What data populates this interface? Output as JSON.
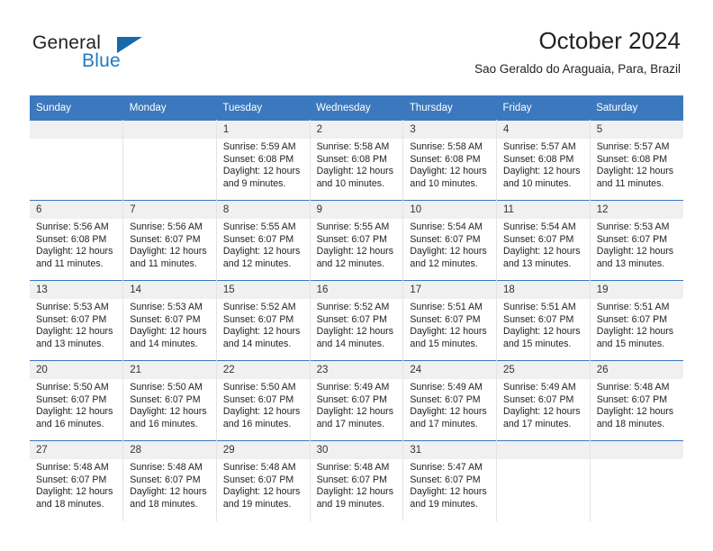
{
  "logo": {
    "word_one": "General",
    "word_two": "Blue",
    "triangle_color": "#1769aa",
    "blue_text_color": "#1f7ac4"
  },
  "header": {
    "title": "October 2024",
    "subtitle": "Sao Geraldo do Araguaia, Para, Brazil",
    "header_bg": "#3b78bd",
    "header_text_color": "#ffffff"
  },
  "weekday_headers": [
    "Sunday",
    "Monday",
    "Tuesday",
    "Wednesday",
    "Thursday",
    "Friday",
    "Saturday"
  ],
  "labels": {
    "sunrise_prefix": "Sunrise:",
    "sunset_prefix": "Sunset:",
    "daylight_prefix": "Daylight:"
  },
  "weeks": [
    [
      {
        "day": "",
        "empty": true
      },
      {
        "day": "",
        "empty": true
      },
      {
        "day": "1",
        "sunrise": "Sunrise: 5:59 AM",
        "sunset": "Sunset: 6:08 PM",
        "daylight_line1": "Daylight: 12 hours",
        "daylight_line2": "and 9 minutes."
      },
      {
        "day": "2",
        "sunrise": "Sunrise: 5:58 AM",
        "sunset": "Sunset: 6:08 PM",
        "daylight_line1": "Daylight: 12 hours",
        "daylight_line2": "and 10 minutes."
      },
      {
        "day": "3",
        "sunrise": "Sunrise: 5:58 AM",
        "sunset": "Sunset: 6:08 PM",
        "daylight_line1": "Daylight: 12 hours",
        "daylight_line2": "and 10 minutes."
      },
      {
        "day": "4",
        "sunrise": "Sunrise: 5:57 AM",
        "sunset": "Sunset: 6:08 PM",
        "daylight_line1": "Daylight: 12 hours",
        "daylight_line2": "and 10 minutes."
      },
      {
        "day": "5",
        "sunrise": "Sunrise: 5:57 AM",
        "sunset": "Sunset: 6:08 PM",
        "daylight_line1": "Daylight: 12 hours",
        "daylight_line2": "and 11 minutes."
      }
    ],
    [
      {
        "day": "6",
        "sunrise": "Sunrise: 5:56 AM",
        "sunset": "Sunset: 6:08 PM",
        "daylight_line1": "Daylight: 12 hours",
        "daylight_line2": "and 11 minutes."
      },
      {
        "day": "7",
        "sunrise": "Sunrise: 5:56 AM",
        "sunset": "Sunset: 6:07 PM",
        "daylight_line1": "Daylight: 12 hours",
        "daylight_line2": "and 11 minutes."
      },
      {
        "day": "8",
        "sunrise": "Sunrise: 5:55 AM",
        "sunset": "Sunset: 6:07 PM",
        "daylight_line1": "Daylight: 12 hours",
        "daylight_line2": "and 12 minutes."
      },
      {
        "day": "9",
        "sunrise": "Sunrise: 5:55 AM",
        "sunset": "Sunset: 6:07 PM",
        "daylight_line1": "Daylight: 12 hours",
        "daylight_line2": "and 12 minutes."
      },
      {
        "day": "10",
        "sunrise": "Sunrise: 5:54 AM",
        "sunset": "Sunset: 6:07 PM",
        "daylight_line1": "Daylight: 12 hours",
        "daylight_line2": "and 12 minutes."
      },
      {
        "day": "11",
        "sunrise": "Sunrise: 5:54 AM",
        "sunset": "Sunset: 6:07 PM",
        "daylight_line1": "Daylight: 12 hours",
        "daylight_line2": "and 13 minutes."
      },
      {
        "day": "12",
        "sunrise": "Sunrise: 5:53 AM",
        "sunset": "Sunset: 6:07 PM",
        "daylight_line1": "Daylight: 12 hours",
        "daylight_line2": "and 13 minutes."
      }
    ],
    [
      {
        "day": "13",
        "sunrise": "Sunrise: 5:53 AM",
        "sunset": "Sunset: 6:07 PM",
        "daylight_line1": "Daylight: 12 hours",
        "daylight_line2": "and 13 minutes."
      },
      {
        "day": "14",
        "sunrise": "Sunrise: 5:53 AM",
        "sunset": "Sunset: 6:07 PM",
        "daylight_line1": "Daylight: 12 hours",
        "daylight_line2": "and 14 minutes."
      },
      {
        "day": "15",
        "sunrise": "Sunrise: 5:52 AM",
        "sunset": "Sunset: 6:07 PM",
        "daylight_line1": "Daylight: 12 hours",
        "daylight_line2": "and 14 minutes."
      },
      {
        "day": "16",
        "sunrise": "Sunrise: 5:52 AM",
        "sunset": "Sunset: 6:07 PM",
        "daylight_line1": "Daylight: 12 hours",
        "daylight_line2": "and 14 minutes."
      },
      {
        "day": "17",
        "sunrise": "Sunrise: 5:51 AM",
        "sunset": "Sunset: 6:07 PM",
        "daylight_line1": "Daylight: 12 hours",
        "daylight_line2": "and 15 minutes."
      },
      {
        "day": "18",
        "sunrise": "Sunrise: 5:51 AM",
        "sunset": "Sunset: 6:07 PM",
        "daylight_line1": "Daylight: 12 hours",
        "daylight_line2": "and 15 minutes."
      },
      {
        "day": "19",
        "sunrise": "Sunrise: 5:51 AM",
        "sunset": "Sunset: 6:07 PM",
        "daylight_line1": "Daylight: 12 hours",
        "daylight_line2": "and 15 minutes."
      }
    ],
    [
      {
        "day": "20",
        "sunrise": "Sunrise: 5:50 AM",
        "sunset": "Sunset: 6:07 PM",
        "daylight_line1": "Daylight: 12 hours",
        "daylight_line2": "and 16 minutes."
      },
      {
        "day": "21",
        "sunrise": "Sunrise: 5:50 AM",
        "sunset": "Sunset: 6:07 PM",
        "daylight_line1": "Daylight: 12 hours",
        "daylight_line2": "and 16 minutes."
      },
      {
        "day": "22",
        "sunrise": "Sunrise: 5:50 AM",
        "sunset": "Sunset: 6:07 PM",
        "daylight_line1": "Daylight: 12 hours",
        "daylight_line2": "and 16 minutes."
      },
      {
        "day": "23",
        "sunrise": "Sunrise: 5:49 AM",
        "sunset": "Sunset: 6:07 PM",
        "daylight_line1": "Daylight: 12 hours",
        "daylight_line2": "and 17 minutes."
      },
      {
        "day": "24",
        "sunrise": "Sunrise: 5:49 AM",
        "sunset": "Sunset: 6:07 PM",
        "daylight_line1": "Daylight: 12 hours",
        "daylight_line2": "and 17 minutes."
      },
      {
        "day": "25",
        "sunrise": "Sunrise: 5:49 AM",
        "sunset": "Sunset: 6:07 PM",
        "daylight_line1": "Daylight: 12 hours",
        "daylight_line2": "and 17 minutes."
      },
      {
        "day": "26",
        "sunrise": "Sunrise: 5:48 AM",
        "sunset": "Sunset: 6:07 PM",
        "daylight_line1": "Daylight: 12 hours",
        "daylight_line2": "and 18 minutes."
      }
    ],
    [
      {
        "day": "27",
        "sunrise": "Sunrise: 5:48 AM",
        "sunset": "Sunset: 6:07 PM",
        "daylight_line1": "Daylight: 12 hours",
        "daylight_line2": "and 18 minutes."
      },
      {
        "day": "28",
        "sunrise": "Sunrise: 5:48 AM",
        "sunset": "Sunset: 6:07 PM",
        "daylight_line1": "Daylight: 12 hours",
        "daylight_line2": "and 18 minutes."
      },
      {
        "day": "29",
        "sunrise": "Sunrise: 5:48 AM",
        "sunset": "Sunset: 6:07 PM",
        "daylight_line1": "Daylight: 12 hours",
        "daylight_line2": "and 19 minutes."
      },
      {
        "day": "30",
        "sunrise": "Sunrise: 5:48 AM",
        "sunset": "Sunset: 6:07 PM",
        "daylight_line1": "Daylight: 12 hours",
        "daylight_line2": "and 19 minutes."
      },
      {
        "day": "31",
        "sunrise": "Sunrise: 5:47 AM",
        "sunset": "Sunset: 6:07 PM",
        "daylight_line1": "Daylight: 12 hours",
        "daylight_line2": "and 19 minutes."
      },
      {
        "day": "",
        "empty": true
      },
      {
        "day": "",
        "empty": true
      }
    ]
  ]
}
